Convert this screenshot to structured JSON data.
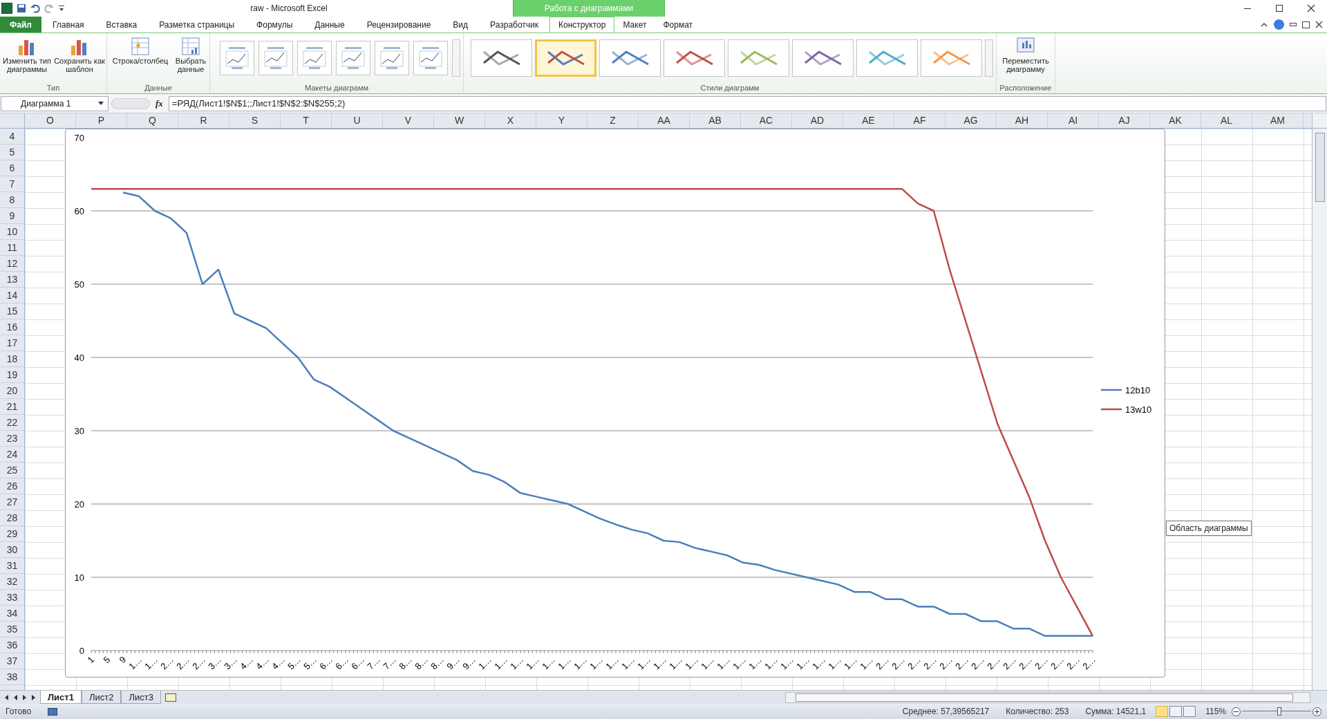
{
  "window": {
    "title": "raw  -  Microsoft Excel",
    "context_group": "Работа с диаграммами"
  },
  "ribbon_tabs": [
    {
      "label": "Файл",
      "kind": "file",
      "selected": false
    },
    {
      "label": "Главная",
      "kind": "tab",
      "selected": false
    },
    {
      "label": "Вставка",
      "kind": "tab",
      "selected": false
    },
    {
      "label": "Разметка страницы",
      "kind": "tab",
      "selected": false
    },
    {
      "label": "Формулы",
      "kind": "tab",
      "selected": false
    },
    {
      "label": "Данные",
      "kind": "tab",
      "selected": false
    },
    {
      "label": "Рецензирование",
      "kind": "tab",
      "selected": false
    },
    {
      "label": "Вид",
      "kind": "tab",
      "selected": false
    },
    {
      "label": "Разработчик",
      "kind": "tab",
      "selected": false
    },
    {
      "label": "Конструктор",
      "kind": "context",
      "selected": true
    },
    {
      "label": "Макет",
      "kind": "context",
      "selected": false
    },
    {
      "label": "Формат",
      "kind": "context",
      "selected": false
    }
  ],
  "ribbon": {
    "type_group": {
      "label": "Тип",
      "buttons": [
        "Изменить тип диаграммы",
        "Сохранить как шаблон"
      ]
    },
    "data_group": {
      "label": "Данные",
      "buttons": [
        "Строка/столбец",
        "Выбрать данные"
      ]
    },
    "layouts_group": {
      "label": "Макеты диаграмм"
    },
    "styles_group": {
      "label": "Стили диаграмм",
      "styles": [
        {
          "selected": false
        },
        {
          "selected": true
        },
        {
          "selected": false
        },
        {
          "selected": false
        },
        {
          "selected": false
        },
        {
          "selected": false
        },
        {
          "selected": false
        },
        {
          "selected": false
        }
      ]
    },
    "location_group": {
      "label": "Расположение",
      "buttons": [
        "Переместить диаграмму"
      ]
    }
  },
  "formula_bar": {
    "name_box": "Диаграмма 1",
    "function_label": "fx",
    "formula": "=РЯД(Лист1!$N$1;;Лист1!$N$2:$N$255;2)"
  },
  "columns": [
    "O",
    "P",
    "Q",
    "R",
    "S",
    "T",
    "U",
    "V",
    "W",
    "X",
    "Y",
    "Z",
    "AA",
    "AB",
    "AC",
    "AD",
    "AE",
    "AF",
    "AG",
    "AH",
    "AI",
    "AJ",
    "AK",
    "AL",
    "AM"
  ],
  "rows": [
    "4",
    "5",
    "6",
    "7",
    "8",
    "9",
    "10",
    "11",
    "12",
    "13",
    "14",
    "15",
    "16",
    "17",
    "18",
    "19",
    "20",
    "21",
    "22",
    "23",
    "24",
    "25",
    "26",
    "27",
    "28",
    "29",
    "30",
    "31",
    "32",
    "33",
    "34",
    "35",
    "36",
    "37",
    "38"
  ],
  "chart": {
    "tooltip": "Область диаграммы",
    "chart_data": {
      "type": "line",
      "categories": [
        "1",
        "5",
        "9",
        "1…",
        "1…",
        "2…",
        "2…",
        "2…",
        "3…",
        "3…",
        "4…",
        "4…",
        "4…",
        "5…",
        "5…",
        "6…",
        "6…",
        "6…",
        "7…",
        "7…",
        "8…",
        "8…",
        "8…",
        "9…",
        "9…",
        "1…",
        "1…",
        "1…",
        "1…",
        "1…",
        "1…",
        "1…",
        "1…",
        "1…",
        "1…",
        "1…",
        "1…",
        "1…",
        "1…",
        "1…",
        "1…",
        "1…",
        "1…",
        "1…",
        "1…",
        "1…",
        "1…",
        "1…",
        "1…",
        "1…",
        "2…",
        "2…",
        "2…",
        "2…",
        "2…",
        "2…",
        "2…",
        "2…",
        "2…",
        "2…",
        "2…",
        "2…",
        "2…",
        "2…"
      ],
      "ylim": [
        0,
        70
      ],
      "grid": true,
      "legend": true,
      "yticks": [
        0,
        10,
        20,
        30,
        40,
        50,
        60,
        70
      ],
      "series": [
        {
          "name": "12b10",
          "color": "#4a7ebb",
          "values": [
            null,
            null,
            62.5,
            62,
            60,
            59,
            57,
            50,
            52,
            46,
            45,
            44,
            42,
            40,
            37,
            36,
            34.5,
            33,
            31.5,
            30,
            29,
            28,
            27,
            26,
            24.5,
            24,
            23,
            21.5,
            21,
            20.5,
            20,
            19,
            18,
            17.2,
            16.5,
            16,
            15,
            14.8,
            14,
            13.5,
            13,
            12,
            11.7,
            11,
            10.5,
            10,
            9.5,
            9,
            8,
            8,
            7,
            7,
            6,
            6,
            5,
            5,
            4,
            4,
            3,
            3,
            2,
            2,
            2,
            2
          ]
        },
        {
          "name": "13w10",
          "color": "#be4b48",
          "values": [
            63,
            63,
            63,
            63,
            63,
            63,
            63,
            63,
            63,
            63,
            63,
            63,
            63,
            63,
            63,
            63,
            63,
            63,
            63,
            63,
            63,
            63,
            63,
            63,
            63,
            63,
            63,
            63,
            63,
            63,
            63,
            63,
            63,
            63,
            63,
            63,
            63,
            63,
            63,
            63,
            63,
            63,
            63,
            63,
            63,
            63,
            63,
            63,
            63,
            63,
            63,
            63,
            61,
            60,
            52,
            45,
            38,
            31,
            26,
            21,
            15,
            10,
            6,
            2
          ]
        }
      ]
    }
  },
  "sheet_tabs": [
    {
      "label": "Лист1",
      "selected": true
    },
    {
      "label": "Лист2",
      "selected": false
    },
    {
      "label": "Лист3",
      "selected": false
    }
  ],
  "status_bar": {
    "status": "Готово",
    "average": "Среднее: 57,39565217",
    "count": "Количество: 253",
    "sum": "Сумма: 14521,1",
    "views": [
      {
        "selected": true
      },
      {
        "selected": false
      },
      {
        "selected": false
      }
    ],
    "zoom": "115%",
    "zoom_slider": {
      "level": 0.54
    }
  }
}
